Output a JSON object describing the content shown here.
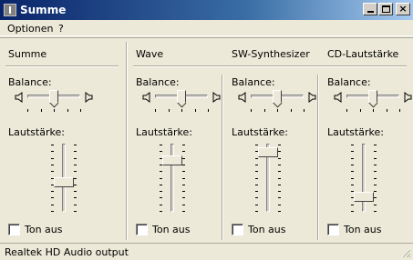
{
  "window": {
    "title": "Summe"
  },
  "menu": {
    "items": [
      "Optionen",
      "?"
    ]
  },
  "panels": [
    {
      "name": "Summe",
      "balance_label": "Balance:",
      "volume_label": "Lautstärke:",
      "mute_label": "Ton aus",
      "mute_checked": false,
      "balance_value": 0.5,
      "volume_value": 0.45
    },
    {
      "name": "Wave",
      "balance_label": "Balance:",
      "volume_label": "Lautstärke:",
      "mute_label": "Ton aus",
      "mute_checked": false,
      "balance_value": 0.5,
      "volume_value": 0.78
    },
    {
      "name": "SW-Synthesizer",
      "balance_label": "Balance:",
      "volume_label": "Lautstärke:",
      "mute_label": "Ton aus",
      "mute_checked": false,
      "balance_value": 0.5,
      "volume_value": 0.92
    },
    {
      "name": "CD-Lautstärke",
      "balance_label": "Balance:",
      "volume_label": "Lautstärke:",
      "mute_label": "Ton aus",
      "mute_checked": false,
      "balance_value": 0.5,
      "volume_value": 0.22
    }
  ],
  "status": {
    "text": "Realtek HD Audio output"
  },
  "colors": {
    "titlebar_start": "#0a246a",
    "titlebar_end": "#a6caf0",
    "background": "#ece9d8"
  }
}
